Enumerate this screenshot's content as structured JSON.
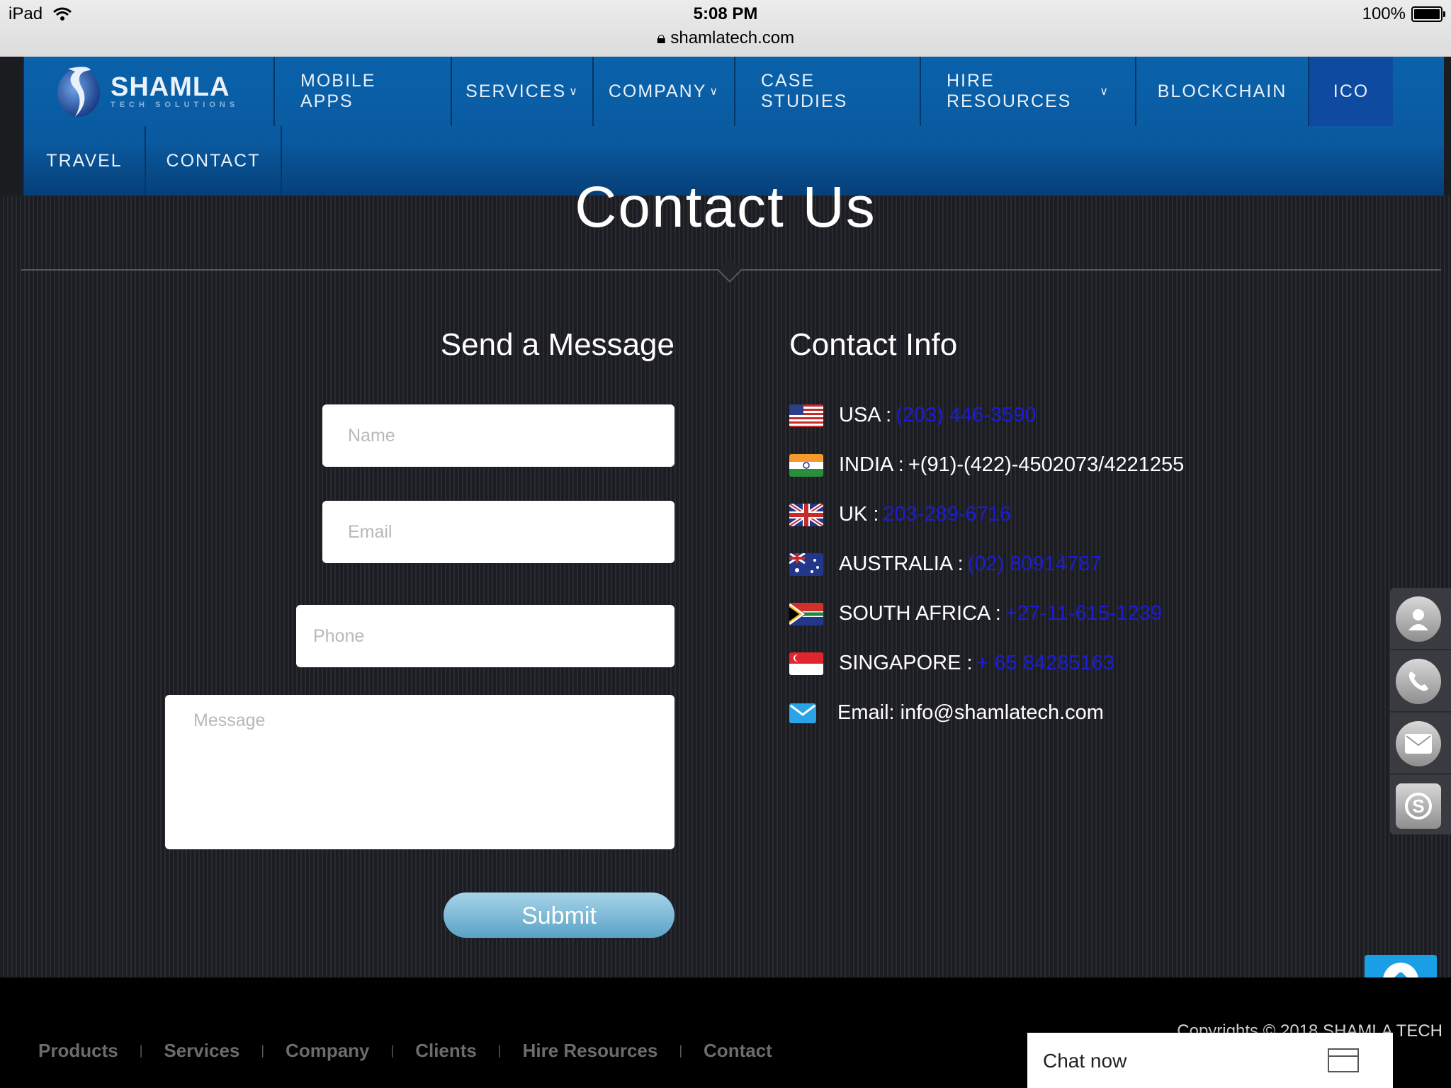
{
  "status_bar": {
    "device": "iPad",
    "time": "5:08 PM",
    "url": "shamlatech.com",
    "battery": "100%"
  },
  "logo": {
    "title": "SHAMLA",
    "subtitle": "TECH SOLUTIONS"
  },
  "nav": {
    "row1": [
      {
        "label": "MOBILE APPS",
        "dropdown": false
      },
      {
        "label": "SERVICES",
        "dropdown": true
      },
      {
        "label": "COMPANY",
        "dropdown": true
      },
      {
        "label": "CASE STUDIES",
        "dropdown": false
      },
      {
        "label": "HIRE RESOURCES",
        "dropdown": true
      },
      {
        "label": "BLOCKCHAIN",
        "dropdown": false
      },
      {
        "label": "ICO",
        "dropdown": false,
        "active": true
      }
    ],
    "row2": [
      {
        "label": "TRAVEL"
      },
      {
        "label": "CONTACT"
      }
    ]
  },
  "page_title": "Contact Us",
  "form": {
    "heading": "Send a Message",
    "name_placeholder": "Name",
    "email_placeholder": "Email",
    "phone_placeholder": "Phone",
    "message_placeholder": "Message",
    "submit_label": "Submit"
  },
  "contact_info": {
    "heading": "Contact Info",
    "rows": [
      {
        "country": "USA :",
        "phone": "(203) 446-3590",
        "linked": true
      },
      {
        "country": "INDIA :",
        "phone": "+(91)-(422)-4502073/4221255",
        "linked": false
      },
      {
        "country": "UK :",
        "phone": "203-289-6716",
        "linked": true
      },
      {
        "country": "AUSTRALIA :",
        "phone": "(02) 80914787",
        "linked": true
      },
      {
        "country": "SOUTH AFRICA :",
        "phone": "+27-11-615-1239",
        "linked": true
      },
      {
        "country": "SINGAPORE :",
        "phone": "+ 65 84285163",
        "linked": true
      }
    ],
    "email": "Email: info@shamlatech.com"
  },
  "float_icons": [
    "user-icon",
    "phone-icon",
    "mail-icon",
    "skype-icon"
  ],
  "footer": {
    "links": [
      "Products",
      "Services",
      "Company",
      "Clients",
      "Hire Resources",
      "Contact"
    ],
    "copyright": "Copyrights © 2018 SHAMLA TECH"
  },
  "chat": {
    "label": "Chat now"
  },
  "colors": {
    "nav_blue": "#0a5aa0",
    "link_blue": "#1c1cd6",
    "scroll_top": "#1a9ee6"
  }
}
